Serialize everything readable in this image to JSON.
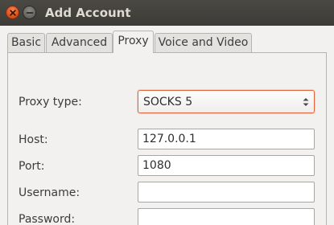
{
  "window": {
    "title": "Add Account"
  },
  "tabs": [
    {
      "label": "Basic",
      "active": false
    },
    {
      "label": "Advanced",
      "active": false
    },
    {
      "label": "Proxy",
      "active": true
    },
    {
      "label": "Voice and Video",
      "active": false
    }
  ],
  "proxy": {
    "type_label": "Proxy type:",
    "type_value": "SOCKS 5",
    "host_label": "Host:",
    "host_value": "127.0.0.1",
    "port_label": "Port:",
    "port_value": "1080",
    "username_label": "Username:",
    "username_value": "",
    "password_label": "Password:",
    "password_value": ""
  },
  "colors": {
    "titlebar": "#3c3b37",
    "close_button": "#e2561f",
    "focus_border": "#e2663b",
    "dialog_bg": "#f2f1f0"
  },
  "icons": {
    "close": "close-icon",
    "minimize": "minimize-icon",
    "combo_arrows": "updown-arrows-icon"
  }
}
